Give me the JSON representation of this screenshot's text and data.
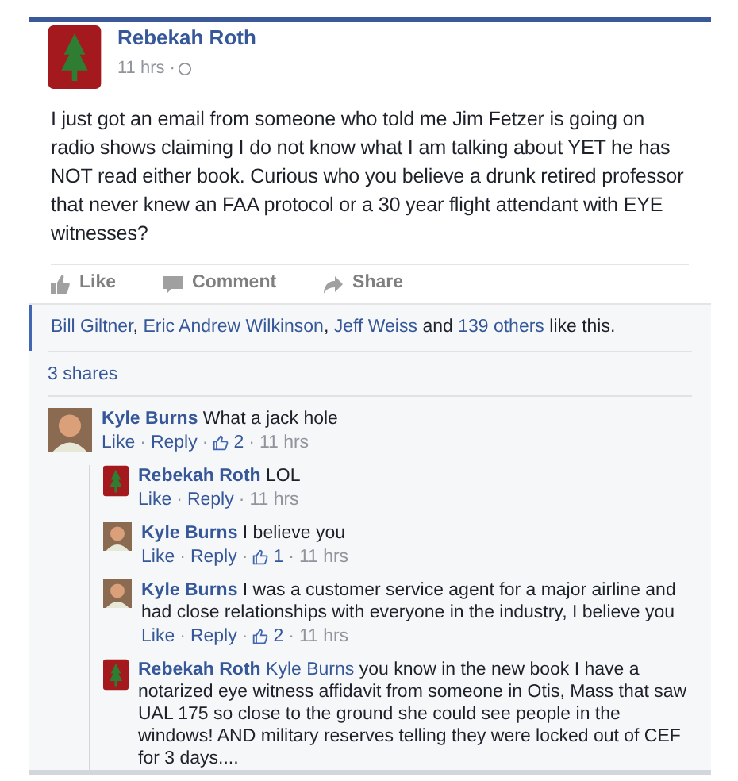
{
  "post": {
    "author": "Rebekah Roth",
    "time": "11 hrs ·",
    "text": "I just got an email from someone who told me Jim Fetzer is going on radio shows claiming I do not know what I am talking about YET he has NOT read either book. Curious who you believe a drunk retired professor that never knew an FAA protocol or a 30 year flight attendant with EYE witnesses?"
  },
  "actions": [
    "Like",
    "Comment",
    "Share"
  ],
  "likes": {
    "names": [
      "Bill Giltner",
      "Eric Andrew Wilkinson",
      "Jeff Weiss"
    ],
    "comma": ",",
    "joiner": "and",
    "others": "139 others",
    "suffix": "like this."
  },
  "shares": "3 shares",
  "dot": "·",
  "comments": [
    {
      "author": "Kyle Burns",
      "kind": "person",
      "text": "What a jack hole",
      "like": "Like",
      "reply": "Reply",
      "likes": "2",
      "time": "11 hrs",
      "children": [
        {
          "author": "Rebekah Roth",
          "kind": "logo",
          "text": "LOL",
          "like": "Like",
          "reply": "Reply",
          "time": "11 hrs"
        },
        {
          "author": "Kyle Burns",
          "kind": "person",
          "text": "I believe you",
          "like": "Like",
          "reply": "Reply",
          "likes": "1",
          "time": "11 hrs"
        },
        {
          "author": "Kyle Burns",
          "kind": "person",
          "text": "I was a customer service agent for a major airline and had close relationships with everyone in the industry, I believe you",
          "like": "Like",
          "reply": "Reply",
          "likes": "2",
          "time": "11 hrs"
        },
        {
          "author": "Rebekah Roth",
          "kind": "logo",
          "mention": "Kyle Burns",
          "text": "you know in the new book I have a notarized eye witness affidavit from someone in Otis, Mass that saw UAL 175 so close to the ground she could see people in the windows! AND military reserves telling they were locked out of CEF for 3 days...."
        }
      ]
    }
  ]
}
